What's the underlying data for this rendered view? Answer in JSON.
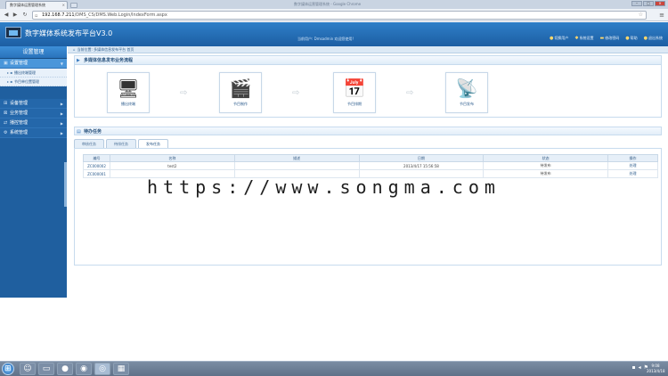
{
  "browser": {
    "tab_title": "数字媒体运营管理系统",
    "tab_close": "×",
    "window_title": "数字媒体运营管理系统 - Google Chrome",
    "url_host": "192.168.7.211",
    "url_path": "/DMS_CS/DMS.Web.Login/IndexForm.aspx",
    "back": "◀",
    "forward": "▶",
    "reload": "↻",
    "min": "–",
    "max": "□",
    "close": "×"
  },
  "header": {
    "title": "数字媒体系统发布平台V3.0",
    "welcome": "当前用户: Dmsadmin 欢迎您使用!",
    "links": [
      {
        "label": "切换用户",
        "icon": "user-icon"
      },
      {
        "label": "系统设置",
        "icon": "settings-icon"
      },
      {
        "label": "修改密码",
        "icon": "key-icon"
      },
      {
        "label": "帮助",
        "icon": "help-icon"
      },
      {
        "label": "退出系统",
        "icon": "exit-icon"
      }
    ]
  },
  "sidebar": {
    "title": "设置管理",
    "groups": [
      {
        "label": "设置管理",
        "active": true
      },
      {
        "label": "设备管理"
      },
      {
        "label": "业务管理"
      },
      {
        "label": "播控管理"
      },
      {
        "label": "系统管理"
      }
    ],
    "sub_items": [
      "播出终端管理",
      "节目单位置管理"
    ]
  },
  "breadcrumb": "当前位置: 多媒体信息发布平台 首页",
  "flow": {
    "title": "多媒体信息发布业务流程",
    "steps": [
      {
        "label": "播出终端",
        "icon": "monitor-icon"
      },
      {
        "label": "节目制作",
        "icon": "clapperboard-icon"
      },
      {
        "label": "节目排期",
        "icon": "schedule-icon"
      },
      {
        "label": "节目发布",
        "icon": "publish-icon"
      }
    ]
  },
  "tasks": {
    "title": "待办任务",
    "tabs": [
      "审核任务",
      "待排任务",
      "发布任务"
    ],
    "active_tab": 2,
    "columns": [
      "编号",
      "名称",
      "描述",
      "日期",
      "状态",
      "操作"
    ],
    "rows": [
      {
        "code": "ZC000002",
        "name": "test2",
        "desc": "",
        "date": "2013/4/17 15:56:58",
        "status": "待发布",
        "action": "处理"
      },
      {
        "code": "ZC000001",
        "name": "",
        "desc": "",
        "date": "",
        "status": "待发布",
        "action": "处理"
      }
    ]
  },
  "watermark": "https://www.songma.com",
  "taskbar": {
    "start": "start-icon",
    "items": [
      "explorer-icon",
      "folder-icon",
      "media-icon",
      "browser-icon",
      "chrome-icon",
      "app-icon"
    ],
    "time": "9:08",
    "date": "2013/4/18"
  }
}
